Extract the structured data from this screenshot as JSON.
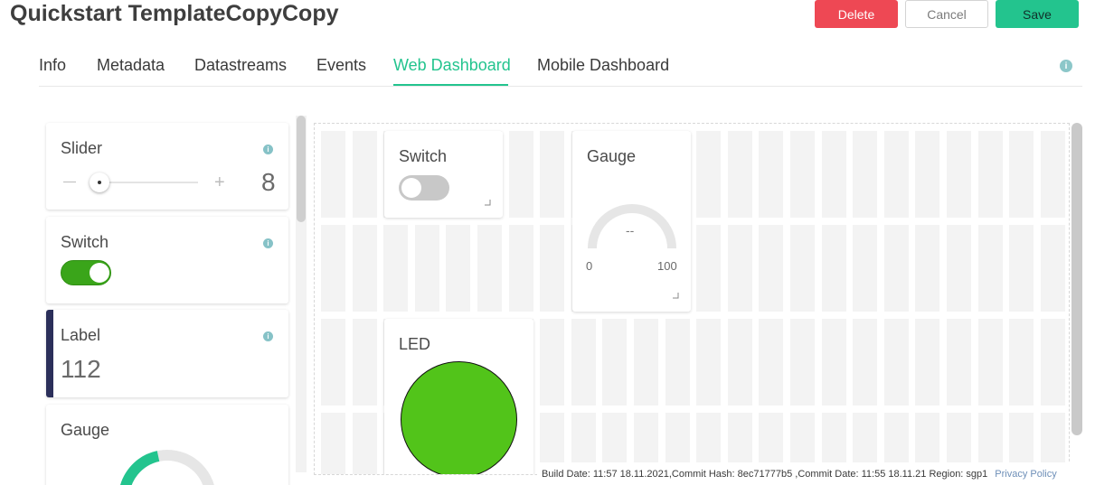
{
  "header": {
    "title": "Quickstart TemplateCopyCopy",
    "delete_label": "Delete",
    "cancel_label": "Cancel",
    "save_label": "Save"
  },
  "tabs": [
    {
      "label": "Info",
      "active": false
    },
    {
      "label": "Metadata",
      "active": false
    },
    {
      "label": "Datastreams",
      "active": false
    },
    {
      "label": "Events",
      "active": false
    },
    {
      "label": "Web Dashboard",
      "active": true
    },
    {
      "label": "Mobile Dashboard",
      "active": false
    }
  ],
  "widget_library": [
    {
      "title": "Slider",
      "value": "8"
    },
    {
      "title": "Switch",
      "state": "on"
    },
    {
      "title": "Label",
      "value": "112"
    },
    {
      "title": "Gauge",
      "progress": 0.18
    }
  ],
  "dashboard": {
    "switch": {
      "title": "Switch",
      "state": "off"
    },
    "gauge": {
      "title": "Gauge",
      "value": "--",
      "min": "0",
      "max": "100"
    },
    "led": {
      "title": "LED",
      "color": "#52c41a"
    }
  },
  "footer": {
    "build": "Build Date: 11:57 18.11.2021,Commit Hash: 8ec71777b5 ,Commit Date: 11:55 18.11.21 Region: sgp1",
    "privacy": "Privacy Policy"
  },
  "colors": {
    "accent": "#23c48e",
    "delete": "#ee4854",
    "switch_on": "#3aa51a",
    "label_accent": "#2b2f5a"
  }
}
